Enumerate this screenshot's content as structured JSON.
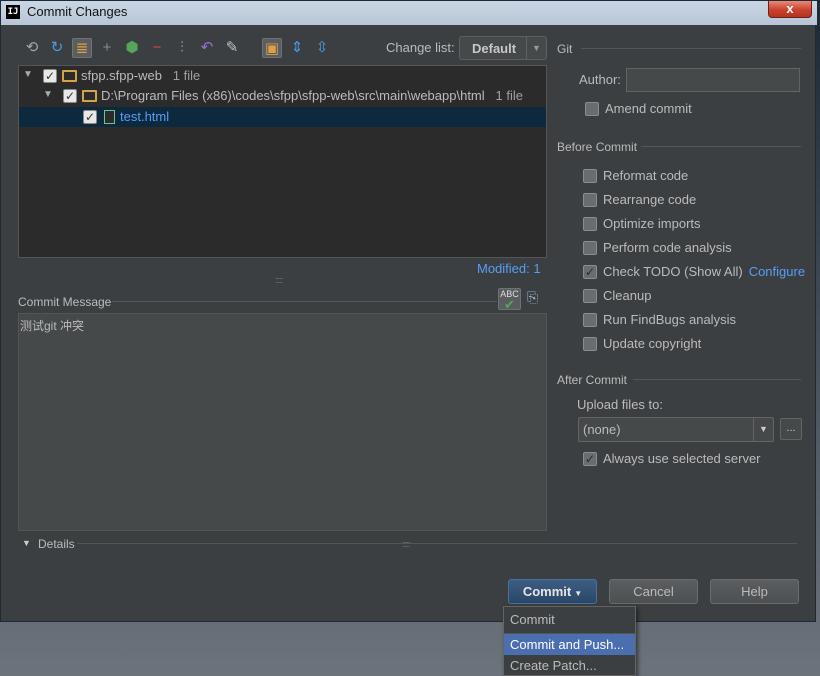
{
  "window": {
    "title": "Commit Changes",
    "close_glyph": "x"
  },
  "toolbar": {
    "changelist_label": "Change list:",
    "changelist_value": "Default",
    "icons": [
      "refresh-with-lock-icon",
      "refresh-icon",
      "group-by-icon",
      "add-icon",
      "git-add-icon",
      "remove-icon",
      "diff-icon",
      "revert-icon",
      "edit-icon",
      "group-by-directory-icon",
      "expand-all-icon",
      "collapse-all-icon"
    ]
  },
  "tree": {
    "root": {
      "name": "sfpp.sfpp-web",
      "count": "1 file"
    },
    "dir": {
      "path": "D:\\Program Files (x86)\\codes\\sfpp\\sfpp-web\\src\\main\\webapp\\html",
      "count": "1 file"
    },
    "file": {
      "name": "test.html"
    }
  },
  "modified_text": "Modified: 1",
  "commit_message": {
    "label": "Commit Message",
    "text": "测试git 冲突",
    "spell_label": "ABC"
  },
  "git": {
    "section": "Git",
    "author_label": "Author:",
    "author_value": "",
    "amend_label": "Amend commit"
  },
  "before_commit": {
    "section": "Before Commit",
    "options": [
      {
        "label": "Reformat code",
        "checked": false
      },
      {
        "label": "Rearrange code",
        "checked": false
      },
      {
        "label": "Optimize imports",
        "checked": false
      },
      {
        "label": "Perform code analysis",
        "checked": false
      },
      {
        "label": "Check TODO (Show All)",
        "checked": true,
        "link": "Configure"
      },
      {
        "label": "Cleanup",
        "checked": false
      },
      {
        "label": "Run FindBugs analysis",
        "checked": false
      },
      {
        "label": "Update copyright",
        "checked": false
      }
    ]
  },
  "after_commit": {
    "section": "After Commit",
    "upload_label": "Upload files to:",
    "upload_value": "(none)",
    "ellipsis": "...",
    "always_label": "Always use selected server"
  },
  "details": {
    "label": "Details"
  },
  "buttons": {
    "commit": "Commit",
    "cancel": "Cancel",
    "help": "Help"
  },
  "dropdown": {
    "items": [
      "Commit",
      "Commit and Push...",
      "Create Patch..."
    ]
  },
  "colors": {
    "background": "#3c3f41",
    "accent": "#589df6",
    "selection": "#0d293e",
    "menu_hover": "#4b6eaf"
  }
}
